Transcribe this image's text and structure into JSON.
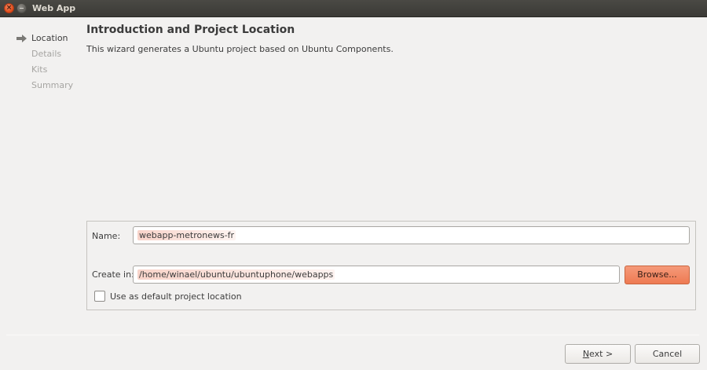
{
  "window": {
    "title": "Web App"
  },
  "nav": {
    "items": [
      {
        "label": "Location"
      },
      {
        "label": "Details"
      },
      {
        "label": "Kits"
      },
      {
        "label": "Summary"
      }
    ],
    "current": "Location"
  },
  "page": {
    "heading": "Introduction and Project Location",
    "description": "This wizard generates a Ubuntu project based on Ubuntu Components."
  },
  "form": {
    "name_label": "Name:",
    "name_value": "webapp-metronews-fr",
    "create_in_label": "Create in:",
    "create_in_value": "/home/winael/ubuntu/ubuntuphone/webapps",
    "browse_label": "Browse...",
    "default_location_label": "Use as default project location",
    "default_location_checked": false
  },
  "buttons": {
    "next_mnemonic": "N",
    "next_rest": "ext >",
    "cancel": "Cancel"
  },
  "colors": {
    "accent": "#ee7a52",
    "titlebar": "#3b3a36",
    "background": "#f2f1f0"
  }
}
